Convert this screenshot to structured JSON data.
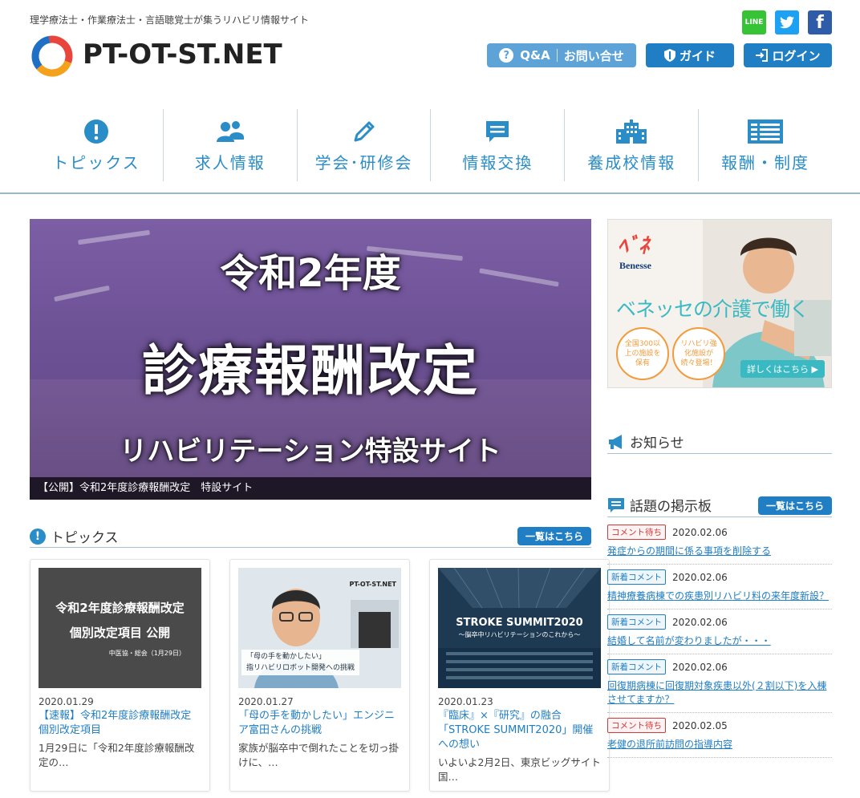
{
  "header": {
    "tagline": "理学療法士・作業療法士・言語聴覚士が集うリハビリ情報サイト",
    "logo_text": "PT-OT-ST.NET",
    "social": {
      "line": "LINE",
      "twitter": "t",
      "facebook": "f"
    },
    "buttons": {
      "qa": "Q&A",
      "contact": "お問い合せ",
      "guide": "ガイド",
      "login": "ログイン"
    }
  },
  "nav": [
    {
      "label": "トピックス",
      "icon": "exclamation-icon"
    },
    {
      "label": "求人情報",
      "icon": "people-icon"
    },
    {
      "label": "学会･研修会",
      "icon": "pencil-icon"
    },
    {
      "label": "情報交換",
      "icon": "chat-icon"
    },
    {
      "label": "養成校情報",
      "icon": "building-icon"
    },
    {
      "label": "報酬・制度",
      "icon": "list-icon"
    }
  ],
  "hero": {
    "line1": "令和2年度",
    "line2": "診療報酬改定",
    "line3": "リハビリテーション特設サイト",
    "caption": "【公開】令和2年度診療報酬改定　特設サイト"
  },
  "topics": {
    "title": "トピックス",
    "more": "一覧はこちら",
    "cards": [
      {
        "img_l1": "令和2年度診療報酬改定",
        "img_l2": "個別改定項目 公開",
        "img_l3": "中医協・総会（1月29日）",
        "date": "2020.01.29",
        "title": "【速報】令和2年度診療報酬改定　個別改定項目",
        "desc": "1月29日に「令和2年度診療報酬改定の…"
      },
      {
        "img_brand": "PT-OT-ST.NET",
        "img_l1": "「母の手を動かしたい」",
        "img_l2": "指リハビリロボット開発への挑戦",
        "date": "2020.01.27",
        "title": "「母の手を動かしたい」エンジニア富田さんの挑戦",
        "desc": "家族が脳卒中で倒れたことを切っ掛けに、…"
      },
      {
        "img_l1": "STROKE SUMMIT2020",
        "img_l2": "～脳卒中リハビリテーションのこれから～",
        "date": "2020.01.23",
        "title": "『臨床』×『研究』の融合「STROKE SUMMIT2020」開催への想い",
        "desc": "いよいよ2月2日、東京ビッグサイト 国…"
      }
    ]
  },
  "ad": {
    "brand": "Benesse",
    "headline": "ベネッセの介護で働く",
    "bubble1": "全国300以上の施設を保有",
    "bubble2": "リハビリ強化施設が続々登場！",
    "cta": "詳しくはこちら ▶"
  },
  "news": {
    "title": "お知らせ"
  },
  "board": {
    "title": "話題の掲示板",
    "more": "一覧はこちら",
    "items": [
      {
        "badge": "コメント待ち",
        "type": "wait",
        "date": "2020.02.06",
        "text": "発症からの期間に係る事項を削除する"
      },
      {
        "badge": "新着コメント",
        "type": "new",
        "date": "2020.02.06",
        "text": "精神療養病棟での疾患別リハビリ料の来年度新設？"
      },
      {
        "badge": "新着コメント",
        "type": "new",
        "date": "2020.02.06",
        "text": "結婚して名前が変わりましたが・・・"
      },
      {
        "badge": "新着コメント",
        "type": "new",
        "date": "2020.02.06",
        "text": "回復期病棟に回復期対象疾患以外(２割以下)を入棟させてますか？"
      },
      {
        "badge": "コメント待ち",
        "type": "wait",
        "date": "2020.02.05",
        "text": "老健の退所前訪問の指導内容"
      }
    ]
  }
}
